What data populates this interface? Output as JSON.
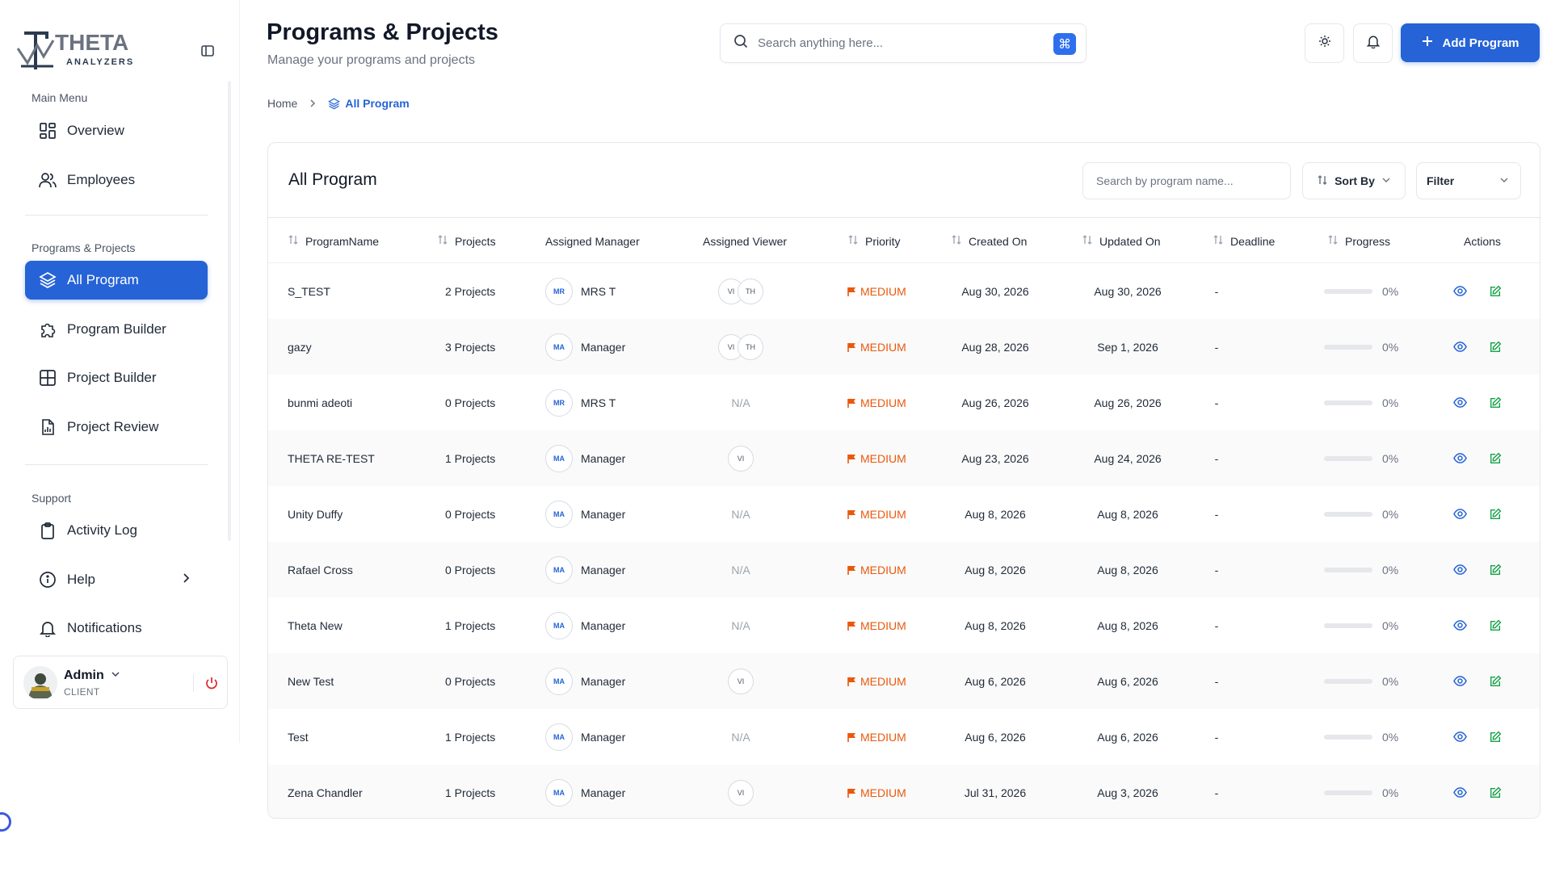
{
  "brand": {
    "logo_text": "THETA",
    "logo_subtext": "ANALYZERS"
  },
  "sidebar": {
    "main_menu_label": "Main Menu",
    "programs_label": "Programs & Projects",
    "support_label": "Support",
    "items": [
      {
        "label": "Overview",
        "icon": "dashboard-grid-icon"
      },
      {
        "label": "Employees",
        "icon": "users-icon"
      },
      {
        "label": "All Program",
        "icon": "layers-icon",
        "active": true
      },
      {
        "label": "Program Builder",
        "icon": "puzzle-icon"
      },
      {
        "label": "Project Builder",
        "icon": "grid-layout-icon"
      },
      {
        "label": "Project Review",
        "icon": "file-chart-icon"
      },
      {
        "label": "Activity Log",
        "icon": "clipboard-icon"
      },
      {
        "label": "Help",
        "icon": "info-circle-icon"
      },
      {
        "label": "Notifications",
        "icon": "bell-icon"
      }
    ],
    "user": {
      "name": "Admin",
      "role": "CLIENT"
    }
  },
  "header": {
    "title": "Programs & Projects",
    "subtitle": "Manage your programs and projects",
    "search_placeholder": "Search anything here...",
    "shortcut_symbol": "⌘",
    "add_button": "Add Program"
  },
  "breadcrumb": {
    "home": "Home",
    "current": "All Program"
  },
  "table_card": {
    "title": "All Program",
    "search_placeholder": "Search by program name...",
    "sort_label": "Sort By",
    "filter_label": "Filter",
    "columns": [
      "ProgramName",
      "Projects",
      "Assigned Manager",
      "Assigned Viewer",
      "Priority",
      "Created On",
      "Updated On",
      "Deadline",
      "Progress",
      "Actions"
    ],
    "rows": [
      {
        "name": "S_TEST",
        "projects": "2 Projects",
        "manager_initials": "MR",
        "manager": "MRS T",
        "viewers": [
          "VI",
          "TH"
        ],
        "viewer_text": "",
        "priority": "MEDIUM",
        "created": "Aug 30, 2026",
        "updated": "Aug 30, 2026",
        "deadline": "-",
        "progress": 0,
        "progress_text": "0%"
      },
      {
        "name": "gazy",
        "projects": "3 Projects",
        "manager_initials": "MA",
        "manager": "Manager",
        "viewers": [
          "VI",
          "TH"
        ],
        "viewer_text": "",
        "priority": "MEDIUM",
        "created": "Aug 28, 2026",
        "updated": "Sep 1, 2026",
        "deadline": "-",
        "progress": 0,
        "progress_text": "0%"
      },
      {
        "name": "bunmi adeoti",
        "projects": "0 Projects",
        "manager_initials": "MR",
        "manager": "MRS T",
        "viewers": [],
        "viewer_text": "N/A",
        "priority": "MEDIUM",
        "created": "Aug 26, 2026",
        "updated": "Aug 26, 2026",
        "deadline": "-",
        "progress": 0,
        "progress_text": "0%"
      },
      {
        "name": "THETA RE-TEST",
        "projects": "1 Projects",
        "manager_initials": "MA",
        "manager": "Manager",
        "viewers": [
          "VI"
        ],
        "viewer_text": "",
        "priority": "MEDIUM",
        "created": "Aug 23, 2026",
        "updated": "Aug 24, 2026",
        "deadline": "-",
        "progress": 0,
        "progress_text": "0%"
      },
      {
        "name": "Unity Duffy",
        "projects": "0 Projects",
        "manager_initials": "MA",
        "manager": "Manager",
        "viewers": [],
        "viewer_text": "N/A",
        "priority": "MEDIUM",
        "created": "Aug 8, 2026",
        "updated": "Aug 8, 2026",
        "deadline": "-",
        "progress": 0,
        "progress_text": "0%"
      },
      {
        "name": "Rafael Cross",
        "projects": "0 Projects",
        "manager_initials": "MA",
        "manager": "Manager",
        "viewers": [],
        "viewer_text": "N/A",
        "priority": "MEDIUM",
        "created": "Aug 8, 2026",
        "updated": "Aug 8, 2026",
        "deadline": "-",
        "progress": 0,
        "progress_text": "0%"
      },
      {
        "name": "Theta New",
        "projects": "1 Projects",
        "manager_initials": "MA",
        "manager": "Manager",
        "viewers": [],
        "viewer_text": "N/A",
        "priority": "MEDIUM",
        "created": "Aug 8, 2026",
        "updated": "Aug 8, 2026",
        "deadline": "-",
        "progress": 0,
        "progress_text": "0%"
      },
      {
        "name": "New Test",
        "projects": "0 Projects",
        "manager_initials": "MA",
        "manager": "Manager",
        "viewers": [
          "VI"
        ],
        "viewer_text": "",
        "priority": "MEDIUM",
        "created": "Aug 6, 2026",
        "updated": "Aug 6, 2026",
        "deadline": "-",
        "progress": 0,
        "progress_text": "0%"
      },
      {
        "name": "Test",
        "projects": "1 Projects",
        "manager_initials": "MA",
        "manager": "Manager",
        "viewers": [],
        "viewer_text": "N/A",
        "priority": "MEDIUM",
        "created": "Aug 6, 2026",
        "updated": "Aug 6, 2026",
        "deadline": "-",
        "progress": 0,
        "progress_text": "0%"
      },
      {
        "name": "Zena Chandler",
        "projects": "1 Projects",
        "manager_initials": "MA",
        "manager": "Manager",
        "viewers": [
          "VI"
        ],
        "viewer_text": "",
        "priority": "MEDIUM",
        "created": "Jul 31, 2026",
        "updated": "Aug 3, 2026",
        "deadline": "-",
        "progress": 0,
        "progress_text": "0%"
      }
    ]
  },
  "colors": {
    "accent": "#2563d6",
    "priority_medium": "#ea580c",
    "action_view": "#2563d6",
    "action_edit": "#16a34a"
  }
}
